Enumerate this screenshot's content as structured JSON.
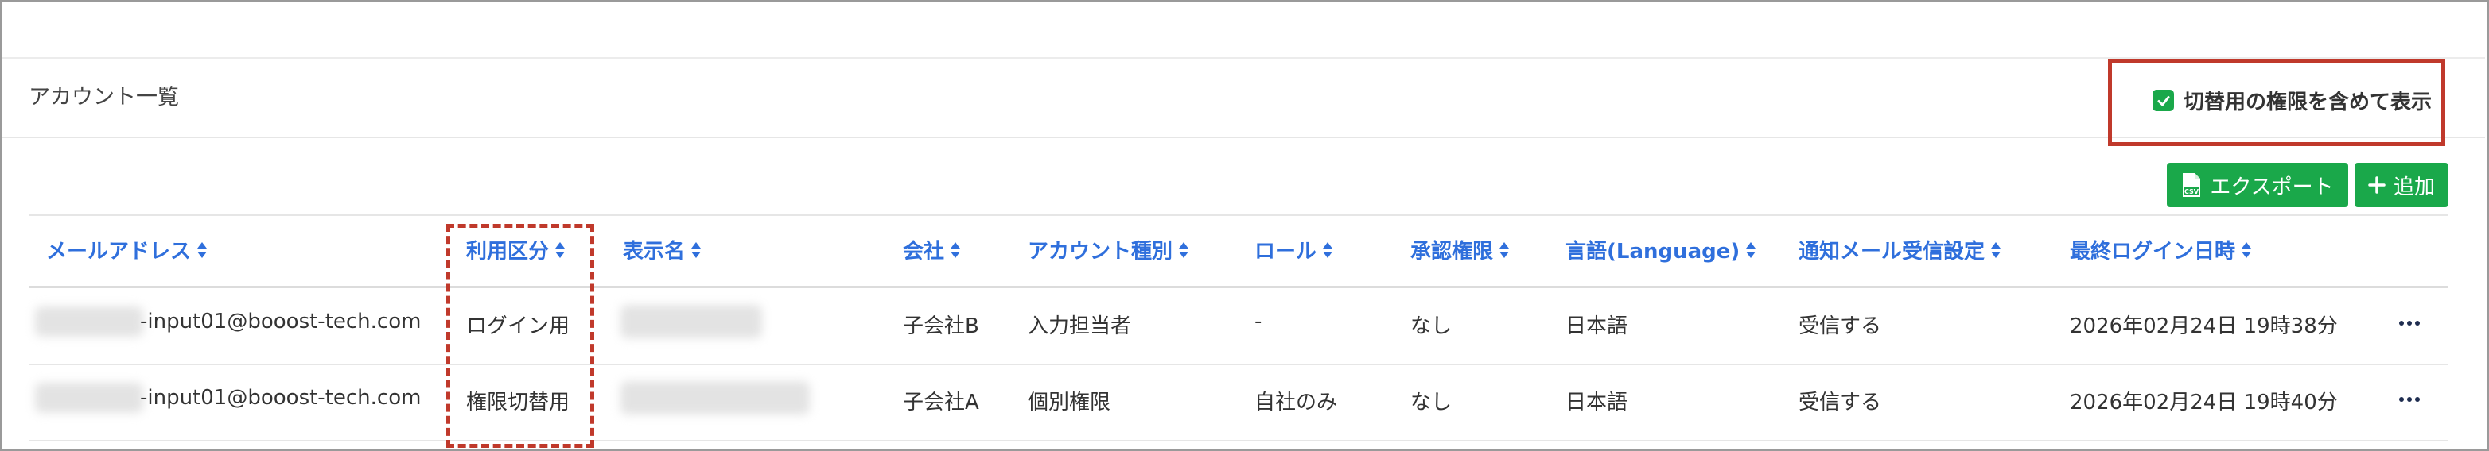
{
  "panel": {
    "title": "アカウント一覧"
  },
  "toggle": {
    "label": "切替用の権限を含めて表示",
    "checked": true
  },
  "toolbar": {
    "export_label": "エクスポート",
    "add_label": "追加"
  },
  "table": {
    "columns": [
      "メールアドレス",
      "利用区分",
      "表示名",
      "会社",
      "アカウント種別",
      "ロール",
      "承認権限",
      "言語(Language)",
      "通知メール受信設定",
      "最終ログイン日時"
    ],
    "rows": [
      {
        "email": "-input01@booost-tech.com",
        "usage": "ログイン用",
        "company": "子会社B",
        "account_type": "入力担当者",
        "role": "-",
        "approval": "なし",
        "language": "日本語",
        "notification": "受信する",
        "last_login": "2026年02月24日 19時38分"
      },
      {
        "email": "-input01@booost-tech.com",
        "usage": "権限切替用",
        "company": "子会社A",
        "account_type": "個別権限",
        "role": "自社のみ",
        "approval": "なし",
        "language": "日本語",
        "notification": "受信する",
        "last_login": "2026年02月24日 19時40分"
      }
    ]
  },
  "colors": {
    "accent_green": "#1aa84a",
    "header_blue": "#2f6fdc",
    "highlight_red": "#c0392b"
  }
}
